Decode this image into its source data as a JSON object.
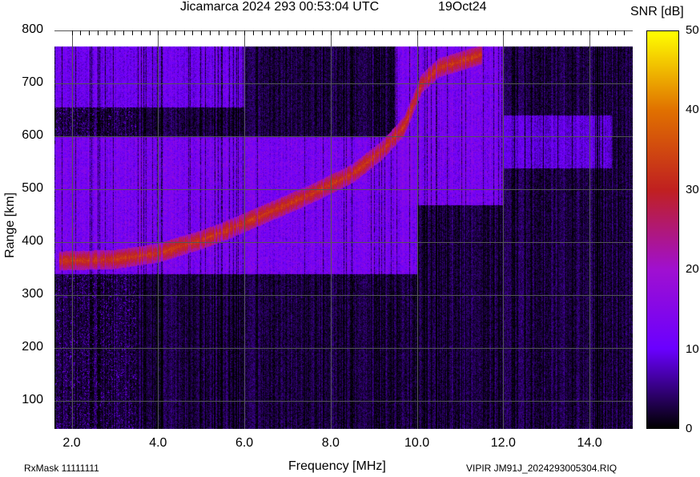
{
  "header": {
    "title": "Jicamarca 2024 293 00:53:04 UTC",
    "date": "19Oct24"
  },
  "footer": {
    "rxmask": "RxMask 11111111",
    "file": "VIPIR  JM91J_2024293005304.RIQ"
  },
  "chart_data": {
    "type": "heatmap",
    "title": "Jicamarca 2024 293 00:53:04 UTC",
    "xlabel": "Frequency [MHz]",
    "ylabel": "Range [km]",
    "xlim": [
      1.6,
      15.0
    ],
    "ylim": [
      47,
      800
    ],
    "data_top_km": 770,
    "xticks": [
      "2.0",
      "4.0",
      "6.0",
      "8.0",
      "10.0",
      "12.0",
      "14.0"
    ],
    "xtick_values": [
      2,
      4,
      6,
      8,
      10,
      12,
      14
    ],
    "yticks": [
      "100",
      "200",
      "300",
      "400",
      "500",
      "600",
      "700",
      "800"
    ],
    "ytick_values": [
      100,
      200,
      300,
      400,
      500,
      600,
      700,
      800
    ],
    "grid": true,
    "colorbar": {
      "label": "SNR [dB]",
      "range": [
        0,
        50
      ],
      "ticks": [
        "0",
        "10",
        "20",
        "30",
        "40",
        "50"
      ],
      "tick_values": [
        0,
        10,
        20,
        30,
        40,
        50
      ],
      "colors": [
        "#000000",
        "#6a00ff",
        "#a010d0",
        "#c02020",
        "#e07000",
        "#ffff00"
      ]
    },
    "o_trace_mhz_km": [
      [
        1.7,
        365
      ],
      [
        3.0,
        368
      ],
      [
        4.0,
        380
      ],
      [
        5.0,
        405
      ],
      [
        5.5,
        420
      ],
      [
        6.5,
        455
      ],
      [
        7.5,
        490
      ],
      [
        8.5,
        530
      ],
      [
        9.2,
        575
      ],
      [
        9.7,
        620
      ],
      [
        10.1,
        700
      ],
      [
        10.5,
        730
      ],
      [
        11.5,
        755
      ]
    ],
    "diffuse_echo_regions": [
      {
        "f": [
          1.6,
          10
        ],
        "km": [
          340,
          600
        ],
        "snr": 14
      },
      {
        "f": [
          1.6,
          6
        ],
        "km": [
          655,
          770
        ],
        "snr": 12
      },
      {
        "f": [
          9.5,
          12
        ],
        "km": [
          470,
          770
        ],
        "snr": 14
      },
      {
        "f": [
          12,
          14.5
        ],
        "km": [
          540,
          640
        ],
        "snr": 10
      }
    ]
  }
}
